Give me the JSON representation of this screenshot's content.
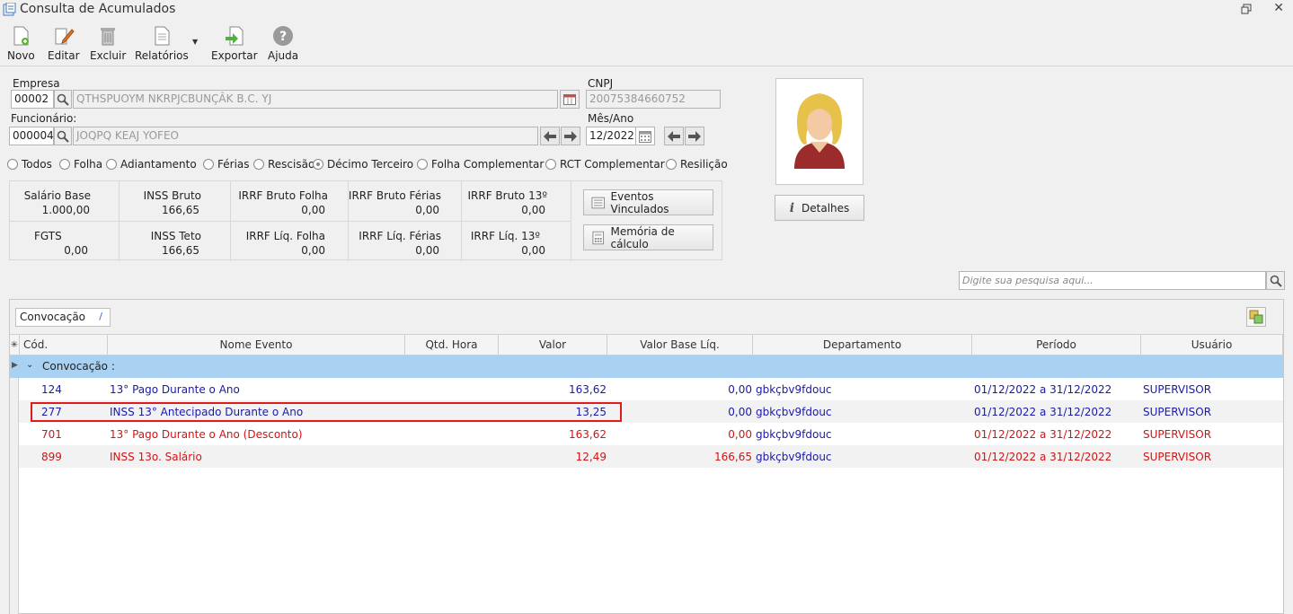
{
  "window": {
    "title": "Consulta de Acumulados"
  },
  "toolbar": {
    "novo": "Novo",
    "editar": "Editar",
    "excluir": "Excluir",
    "relatorios": "Relatórios",
    "exportar": "Exportar",
    "ajuda": "Ajuda"
  },
  "form": {
    "empresa_label": "Empresa",
    "empresa_code": "00002",
    "empresa_name": "QTHSPUOYM NKRPJCBUNÇÂK B.C. YJ",
    "cnpj_label": "CNPJ",
    "cnpj_value": "20075384660752",
    "funcionario_label": "Funcionário:",
    "funcionario_code": "000004",
    "funcionario_name": "JOQPQ KEAJ YOFEO",
    "mesano_label": "Mês/Ano",
    "mesano_value": "12/2022"
  },
  "filters": [
    {
      "label": "Todos",
      "selected": false
    },
    {
      "label": "Folha",
      "selected": false
    },
    {
      "label": "Adiantamento",
      "selected": false
    },
    {
      "label": "Férias",
      "selected": false
    },
    {
      "label": "Rescisão",
      "selected": false
    },
    {
      "label": "Décimo Terceiro",
      "selected": true
    },
    {
      "label": "Folha Complementar",
      "selected": false
    },
    {
      "label": "RCT Complementar",
      "selected": false
    },
    {
      "label": "Resilição",
      "selected": false
    }
  ],
  "summary": {
    "row1": [
      {
        "title": "Salário Base",
        "value": "1.000,00"
      },
      {
        "title": "INSS Bruto",
        "value": "166,65"
      },
      {
        "title": "IRRF Bruto Folha",
        "value": "0,00"
      },
      {
        "title": "IRRF Bruto Férias",
        "value": "0,00"
      },
      {
        "title": "IRRF Bruto 13º",
        "value": "0,00"
      }
    ],
    "row2": [
      {
        "title": "FGTS",
        "value": "0,00"
      },
      {
        "title": "INSS Teto",
        "value": "166,65"
      },
      {
        "title": "IRRF Líq. Folha",
        "value": "0,00"
      },
      {
        "title": "IRRF Líq. Férias",
        "value": "0,00"
      },
      {
        "title": "IRRF Líq. 13º",
        "value": "0,00"
      }
    ]
  },
  "actions": {
    "eventos_vinculados": "Eventos Vinculados",
    "memoria_calculo": "Memória de cálculo",
    "detalhes": "Detalhes"
  },
  "search": {
    "placeholder": "Digite sua pesquisa aqui..."
  },
  "grid": {
    "group_chip": "Convocação",
    "columns": [
      "Cód.",
      "Nome Evento",
      "Qtd. Hora",
      "Valor",
      "Valor Base Líq.",
      "Departamento",
      "Período",
      "Usuário"
    ],
    "group_label": "Convocação :",
    "rows": [
      {
        "cod": "124",
        "nome": "13° Pago Durante o Ano",
        "qtd": "",
        "valor": "163,62",
        "base": "0,00",
        "depto": "gbkçbv9fdouc",
        "periodo": "01/12/2022 a 31/12/2022",
        "usuario": "SUPERVISOR",
        "color": "#1a1aa8"
      },
      {
        "cod": "277",
        "nome": "INSS 13° Antecipado Durante o Ano",
        "qtd": "",
        "valor": "13,25",
        "base": "0,00",
        "depto": "gbkçbv9fdouc",
        "periodo": "01/12/2022 a 31/12/2022",
        "usuario": "SUPERVISOR",
        "color": "#1a1aa8"
      },
      {
        "cod": "701",
        "nome": "13° Pago Durante o Ano (Desconto)",
        "qtd": "",
        "valor": "163,62",
        "base": "0,00",
        "depto": "gbkçbv9fdouc",
        "periodo": "01/12/2022 a 31/12/2022",
        "usuario": "SUPERVISOR",
        "color": "#d01515"
      },
      {
        "cod": "899",
        "nome": "INSS 13o. Salário",
        "qtd": "",
        "valor": "12,49",
        "base": "166,65",
        "depto": "gbkçbv9fdouc",
        "periodo": "01/12/2022 a 31/12/2022",
        "usuario": "SUPERVISOR",
        "color": "#d01515"
      }
    ]
  }
}
